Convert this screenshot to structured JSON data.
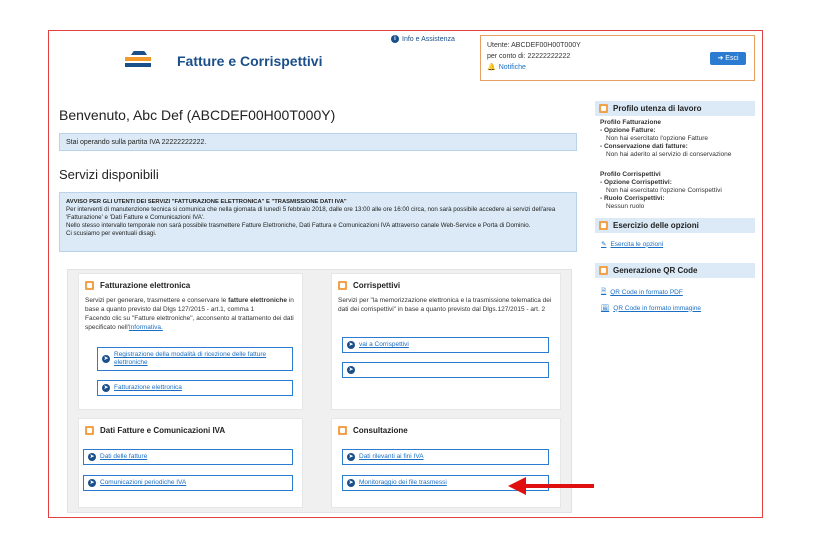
{
  "header": {
    "app_title": "Fatture e Corrispettivi",
    "info_link": "Info e Assistenza",
    "user_line": "Utente: ABCDEF00H00T000Y",
    "account_line": "per conto di: 22222222222",
    "notifications": "Notifiche",
    "logout": "Esci"
  },
  "welcome": "Benvenuto, Abc Def (ABCDEF00H00T000Y)",
  "partita_iva_notice": "Stai operando sulla partita IVA 22222222222.",
  "section_title": "Servizi disponibili",
  "notice": {
    "title": "AVVISO PER GLI UTENTI DEI SERVIZI \"FATTURAZIONE ELETTRONICA\" E \"TRASMISSIONE DATI IVA\"",
    "line1": "Per interventi di manutenzione tecnica si comunica che nella giornata di lunedì 5 febbraio 2018, dalle ore 13:00 alle ore 16:00 circa, non sarà possibile accedere ai servizi dell'area 'Fatturazione' e 'Dati Fatture e Comunicazioni IVA'.",
    "line2": "Nello stesso intervallo temporale non sarà possibile trasmettere Fatture Elettroniche, Dati Fattura e Comunicazioni IVA attraverso canale Web-Service e Porta di Dominio.",
    "line3": "Ci scusiamo per eventuali disagi."
  },
  "cards": {
    "fatturazione": {
      "title": "Fatturazione elettronica",
      "desc_1": "Servizi per generare, trasmettere e conservare le ",
      "desc_bold": "fatture elettroniche",
      "desc_2": " in base a quanto previsto dal Dlgs 127/2015 - art.1, comma 1",
      "desc_3": "Facendo clic su \"Fatture elettroniche\", acconsento al trattamento dei dati specificato nell'",
      "desc_link": "Informativa.",
      "btn1": "Registrazione della modalità di ricezione delle fatture elettroniche",
      "btn2": "Fatturazione elettronica"
    },
    "corrispettivi": {
      "title": "Corrispettivi",
      "desc": "Servizi per \"la memorizzazione elettronica e la trasmissione telematica dei dati dei corrispettivi\" in base a quanto previsto dal Dlgs.127/2015 - art. 2",
      "btn1": "vai a Corrispettivi",
      "btn2": ""
    },
    "dati_fatture": {
      "title": "Dati Fatture e Comunicazioni IVA",
      "btn1": "Dati delle fatture",
      "btn2": "Comunicazioni periodiche IVA"
    },
    "consultazione": {
      "title": "Consultazione",
      "btn1": "Dati rilevanti ai fini IVA",
      "btn2": "Monitoraggio dei file trasmessi"
    }
  },
  "sidebar": {
    "profilo_title": "Profilo utenza di lavoro",
    "profilo_fatt_title": "Profilo Fatturazione",
    "opzione_fatture_label": "- Opzione Fatture:",
    "opzione_fatture_value": "Non hai esercitato l'opzione Fatture",
    "conservazione_label": "- Conservazione dati fatture:",
    "conservazione_value": "Non hai aderito al servizio di conservazione",
    "profilo_corr_title": "Profilo Corrispettivi",
    "opzione_corr_label": "- Opzione Corrispettivi:",
    "opzione_corr_value": "Non hai esercitato l'opzione Corrispettivi",
    "ruolo_label": "- Ruolo Corrispettivi:",
    "ruolo_value": "Nessun ruolo",
    "esercizio_title": "Esercizio delle opzioni",
    "esercita_link": "Esercita le opzioni",
    "qr_title": "Generazione QR Code",
    "qr_pdf": "QR Code in formato PDF",
    "qr_img": "QR Code in formato immagine"
  },
  "colors": {
    "accent": "#f2a24a",
    "link": "#1a6fc4",
    "title": "#1a4f8a",
    "highlight_arrow": "#e01010"
  }
}
